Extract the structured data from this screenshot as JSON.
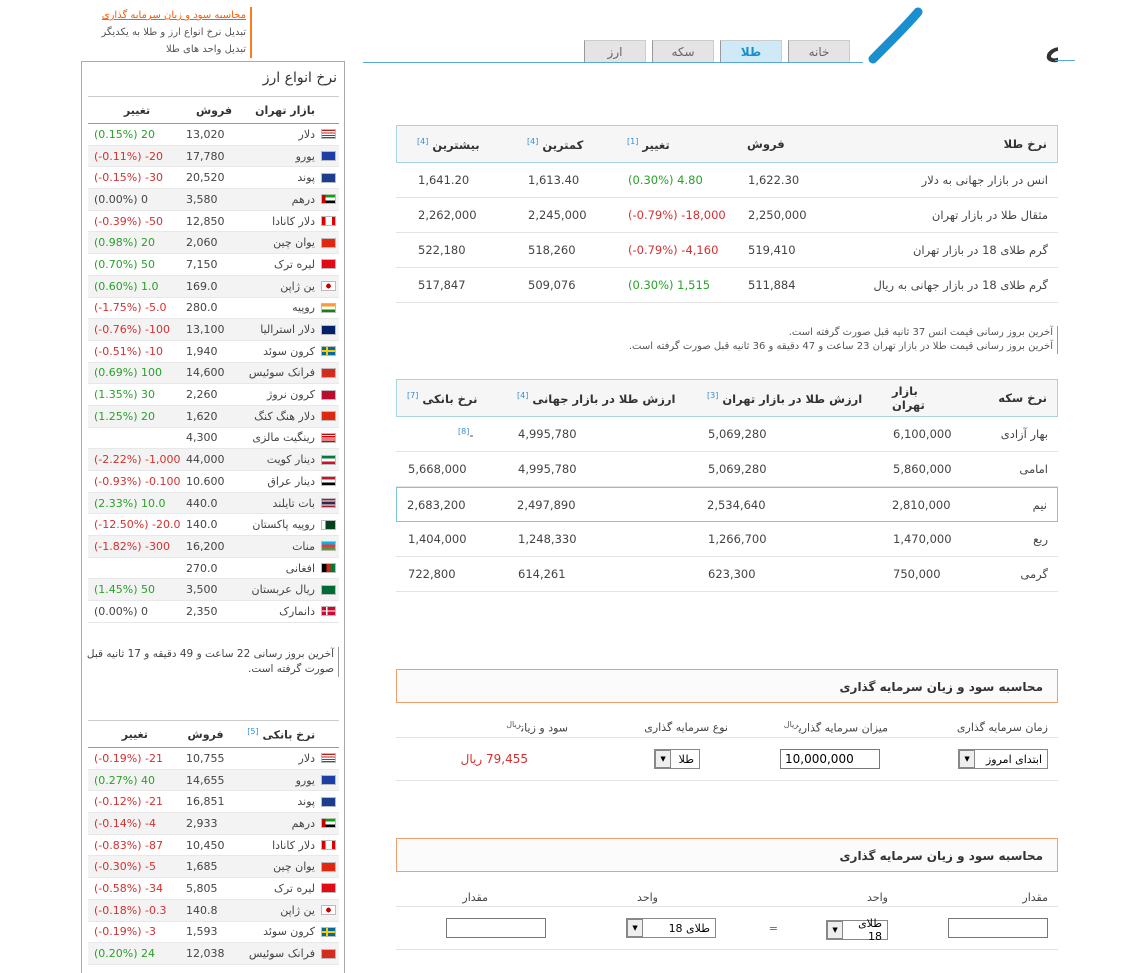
{
  "top_links": [
    "محاسبه سود و زیان سرمایه گذاری",
    "تبدیل نرخ انواع ارز و طلا به یکدیگر",
    "تبدیل واحد های طلا"
  ],
  "logo_text": "مزنه",
  "tabs": [
    "خانه",
    "طلا",
    "سکه",
    "ارز"
  ],
  "currency": {
    "title": "نرخ انواع ارز",
    "headers": {
      "market": "بازار تهران",
      "sell": "فروش",
      "change": "تغییر"
    },
    "rows": [
      {
        "name": "دلار",
        "flag": "us",
        "sell": "13,020",
        "change": "(0.15%) 20",
        "dir": "up"
      },
      {
        "name": "یورو",
        "flag": "eu",
        "sell": "17,780",
        "change": "(-0.11%) -20",
        "dir": "down"
      },
      {
        "name": "پوند",
        "flag": "gb",
        "sell": "20,520",
        "change": "(-0.15%) -30",
        "dir": "down"
      },
      {
        "name": "درهم",
        "flag": "ae",
        "sell": "3,580",
        "change": "(0.00%) 0",
        "dir": "none"
      },
      {
        "name": "دلار کانادا",
        "flag": "ca",
        "sell": "12,850",
        "change": "(-0.39%) -50",
        "dir": "down"
      },
      {
        "name": "یوان چین",
        "flag": "cn",
        "sell": "2,060",
        "change": "(0.98%) 20",
        "dir": "up"
      },
      {
        "name": "لیره ترک",
        "flag": "tr",
        "sell": "7,150",
        "change": "(0.70%) 50",
        "dir": "up"
      },
      {
        "name": "ین ژاپن",
        "flag": "jp",
        "sell": "169.0",
        "change": "(0.60%) 1.0",
        "dir": "up"
      },
      {
        "name": "روپیه",
        "flag": "in",
        "sell": "280.0",
        "change": "(-1.75%) -5.0",
        "dir": "down"
      },
      {
        "name": "دلار استرالیا",
        "flag": "au",
        "sell": "13,100",
        "change": "(-0.76%) -100",
        "dir": "down"
      },
      {
        "name": "کرون سوئد",
        "flag": "se",
        "sell": "1,940",
        "change": "(-0.51%) -10",
        "dir": "down"
      },
      {
        "name": "فرانک سوئیس",
        "flag": "ch",
        "sell": "14,600",
        "change": "(0.69%) 100",
        "dir": "up"
      },
      {
        "name": "کرون نروژ",
        "flag": "no",
        "sell": "2,260",
        "change": "(1.35%) 30",
        "dir": "up"
      },
      {
        "name": "دلار هنگ کنگ",
        "flag": "hk",
        "sell": "1,620",
        "change": "(1.25%) 20",
        "dir": "up"
      },
      {
        "name": "رینگیت مالزی",
        "flag": "my",
        "sell": "4,300",
        "change": "",
        "dir": "none"
      },
      {
        "name": "دینار کویت",
        "flag": "kw",
        "sell": "44,000",
        "change": "(-2.22%) -1,000",
        "dir": "down"
      },
      {
        "name": "دینار عراق",
        "flag": "iq",
        "sell": "10.600",
        "change": "(-0.93%) -0.100",
        "dir": "down"
      },
      {
        "name": "بات تایلند",
        "flag": "th",
        "sell": "440.0",
        "change": "(2.33%) 10.0",
        "dir": "up"
      },
      {
        "name": "روپیه پاکستان",
        "flag": "pk",
        "sell": "140.0",
        "change": "(-12.50%) -20.0",
        "dir": "down"
      },
      {
        "name": "منات",
        "flag": "az",
        "sell": "16,200",
        "change": "(-1.82%) -300",
        "dir": "down"
      },
      {
        "name": "افغانی",
        "flag": "af",
        "sell": "270.0",
        "change": "",
        "dir": "none"
      },
      {
        "name": "ریال عربستان",
        "flag": "sa",
        "sell": "3,500",
        "change": "(1.45%) 50",
        "dir": "up"
      },
      {
        "name": "دانمارک",
        "flag": "dk",
        "sell": "2,350",
        "change": "(0.00%) 0",
        "dir": "none"
      }
    ],
    "note": "آخرین بروز رسانی 22 ساعت و 49 دقیقه و 17 ثانیه قبل صورت گرفته است."
  },
  "bank": {
    "headers": {
      "market": "نرخ بانکی",
      "ref": "[5]",
      "sell": "فروش",
      "change": "تغییر"
    },
    "rows": [
      {
        "name": "دلار",
        "flag": "us",
        "sell": "10,755",
        "change": "(-0.19%) -21",
        "dir": "down"
      },
      {
        "name": "یورو",
        "flag": "eu",
        "sell": "14,655",
        "change": "(0.27%) 40",
        "dir": "up"
      },
      {
        "name": "پوند",
        "flag": "gb",
        "sell": "16,851",
        "change": "(-0.12%) -21",
        "dir": "down"
      },
      {
        "name": "درهم",
        "flag": "ae",
        "sell": "2,933",
        "change": "(-0.14%) -4",
        "dir": "down"
      },
      {
        "name": "دلار کانادا",
        "flag": "ca",
        "sell": "10,450",
        "change": "(-0.83%) -87",
        "dir": "down"
      },
      {
        "name": "یوان چین",
        "flag": "cn",
        "sell": "1,685",
        "change": "(-0.30%) -5",
        "dir": "down"
      },
      {
        "name": "لیره ترک",
        "flag": "tr",
        "sell": "5,805",
        "change": "(-0.58%) -34",
        "dir": "down"
      },
      {
        "name": "ین ژاپن",
        "flag": "jp",
        "sell": "140.8",
        "change": "(-0.18%) -0.3",
        "dir": "down"
      },
      {
        "name": "کرون سوئد",
        "flag": "se",
        "sell": "1,593",
        "change": "(-0.19%) -3",
        "dir": "down"
      },
      {
        "name": "فرانک سوئیس",
        "flag": "ch",
        "sell": "12,038",
        "change": "(0.20%) 24",
        "dir": "up"
      }
    ]
  },
  "gold": {
    "headers": [
      "نرخ طلا",
      "فروش",
      "تغییر",
      "کمترین",
      "بیشترین"
    ],
    "refs": [
      "",
      "",
      "[1]",
      "[4]",
      "[4]"
    ],
    "rows": [
      {
        "name": "انس در بازار جهانی به دلار",
        "sell": "1,622.30",
        "change": "(0.30%) 4.80",
        "dir": "up",
        "min": "1,613.40",
        "max": "1,641.20"
      },
      {
        "name": "مثقال طلا در بازار تهران",
        "sell": "2,250,000",
        "change": "(-0.79%) -18,000",
        "dir": "down",
        "min": "2,245,000",
        "max": "2,262,000"
      },
      {
        "name": "گرم طلای 18 در بازار تهران",
        "sell": "519,410",
        "change": "(-0.79%) -4,160",
        "dir": "down",
        "min": "518,260",
        "max": "522,180"
      },
      {
        "name": "گرم طلای 18 در بازار جهانی به ریال",
        "sell": "511,884",
        "change": "(0.30%) 1,515",
        "dir": "up",
        "min": "509,076",
        "max": "517,847"
      }
    ],
    "notes": [
      "آخرین بروز رسانی قیمت انس 37 ثانیه قبل صورت گرفته است.",
      "آخرین بروز رسانی قیمت طلا در بازار تهران 23 ساعت و 47 دقیقه و 36 ثانیه قبل صورت گرفته است."
    ]
  },
  "coins": {
    "headers": [
      "نرخ سکه",
      "بازار تهران",
      "ارزش طلا در بازار تهران",
      "ارزش طلا در بازار جهانی",
      "نرخ بانکی"
    ],
    "refs": [
      "",
      "",
      "[3]",
      "[4]",
      "[7]"
    ],
    "rows": [
      {
        "name": "بهار آزادی",
        "market": "6,100,000",
        "tehran": "5,069,280",
        "world": "4,995,780",
        "bank": "-",
        "bank_ref": "[8]"
      },
      {
        "name": "امامی",
        "market": "5,860,000",
        "tehran": "5,069,280",
        "world": "4,995,780",
        "bank": "5,668,000",
        "bank_ref": ""
      },
      {
        "name": "نیم",
        "market": "2,810,000",
        "tehran": "2,534,640",
        "world": "2,497,890",
        "bank": "2,683,200",
        "bank_ref": ""
      },
      {
        "name": "ربع",
        "market": "1,470,000",
        "tehran": "1,266,700",
        "world": "1,248,330",
        "bank": "1,404,000",
        "bank_ref": ""
      },
      {
        "name": "گرمی",
        "market": "750,000",
        "tehran": "623,300",
        "world": "614,261",
        "bank": "722,800",
        "bank_ref": ""
      }
    ]
  },
  "calc1": {
    "title": "محاسبه سود و زیان سرمایه گذاری",
    "labels": {
      "time": "زمان سرمایه گذاری",
      "amount": "میزان سرمایه گذاری",
      "amount_unit": "ریال",
      "type": "نوع سرمایه گذاری",
      "profit": "سود و زیان",
      "profit_unit": "ریال"
    },
    "time_value": "ابتدای امروز",
    "amount_value": "10,000,000",
    "type_value": "طلا",
    "result": "79,455 ریال"
  },
  "calc2": {
    "title": "محاسبه سود و زیان سرمایه گذاری",
    "labels": {
      "amount1": "مقدار",
      "unit1": "واحد",
      "unit2": "واحد",
      "amount2": "مقدار"
    },
    "unit1_value": "طلای 18",
    "equals": "=",
    "unit2_value": "طلای 18",
    "amount1_value": "",
    "amount2_value": ""
  },
  "colors": {
    "up": "#2aa02a",
    "down": "#d43030",
    "accent": "#1a8fd0",
    "orange": "#ff7a1a"
  }
}
